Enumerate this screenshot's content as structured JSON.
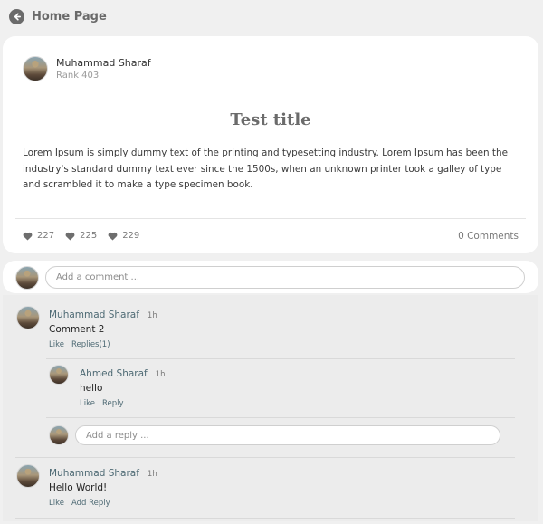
{
  "nav": {
    "title": "Home Page",
    "back_icon": "arrow-left-circle-icon"
  },
  "post": {
    "author_name": "Muhammad Sharaf",
    "author_rank": "Rank 403",
    "title": "Test title",
    "body": "Lorem Ipsum is simply dummy text of the printing and typesetting industry. Lorem Ipsum has been the industry's standard dummy text ever since the 1500s, when an unknown printer took a galley of type and scrambled it to make a type specimen book.",
    "reactions": [
      "227",
      "225",
      "229"
    ],
    "comments_count": "0 Comments"
  },
  "add_comment": {
    "placeholder": "Add a comment ..."
  },
  "comments": [
    {
      "name": "Muhammad Sharaf",
      "time": "1h",
      "text": "Comment 2",
      "like": "Like",
      "secondary": "Replies(1)",
      "replies": [
        {
          "name": "Ahmed Sharaf",
          "time": "1h",
          "text": "hello",
          "like": "Like",
          "reply": "Reply"
        }
      ],
      "reply_placeholder": "Add a reply ..."
    },
    {
      "name": "Muhammad Sharaf",
      "time": "1h",
      "text": "Hello World!",
      "like": "Like",
      "secondary": "Add Reply"
    }
  ],
  "colors": {
    "background": "#f0f0f0",
    "card": "#ffffff",
    "accent_name": "#4e6a74",
    "muted": "#7a7a7a"
  }
}
